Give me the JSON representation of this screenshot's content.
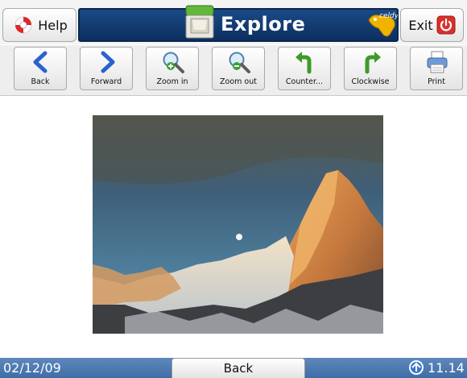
{
  "topbar": {
    "help_label": "Help",
    "title": "Explore",
    "logo_text": "celdy",
    "exit_label": "Exit"
  },
  "toolbar": {
    "items": [
      {
        "label": "Back",
        "icon": "arrow-left-icon"
      },
      {
        "label": "Forward",
        "icon": "arrow-right-icon"
      },
      {
        "label": "Zoom in",
        "icon": "zoom-in-icon"
      },
      {
        "label": "Zoom out",
        "icon": "zoom-out-icon"
      },
      {
        "label": "Counter...",
        "icon": "rotate-counterclockwise-icon"
      },
      {
        "label": "Clockwise",
        "icon": "rotate-clockwise-icon"
      },
      {
        "label": "Print",
        "icon": "printer-icon"
      }
    ]
  },
  "statusbar": {
    "date": "02/12/09",
    "back_label": "Back",
    "time": "11.14"
  },
  "colors": {
    "title_bar": "#123d73",
    "status_bar": "#4a78b0",
    "arrow_blue": "#2a63d0",
    "rotate_green": "#3f9a2a",
    "exit_red": "#d9302a"
  }
}
